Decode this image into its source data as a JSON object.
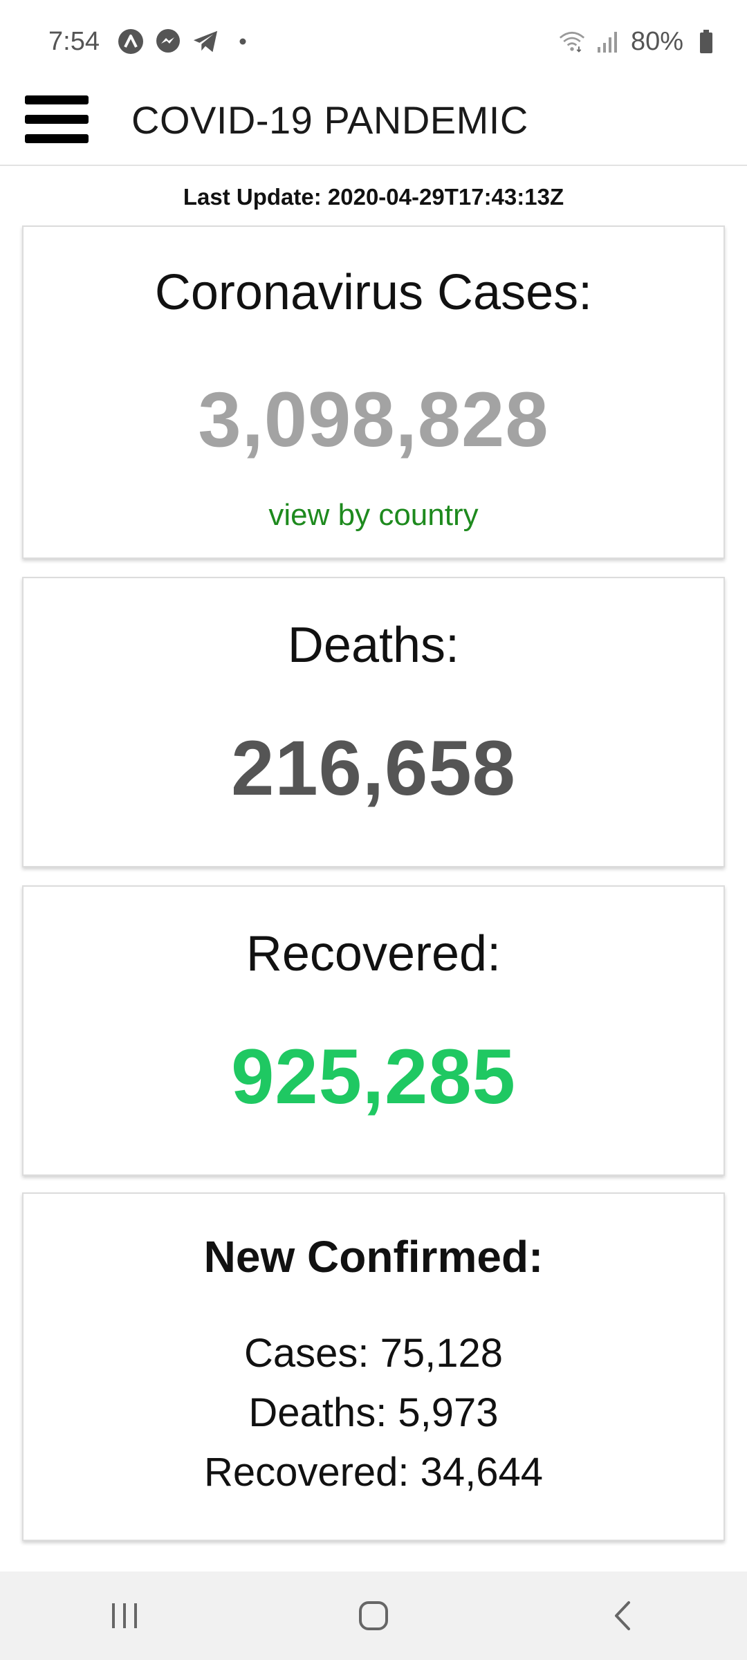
{
  "status_bar": {
    "time": "7:54",
    "battery": "80%",
    "icons": [
      "app-a-icon",
      "messenger-icon",
      "telegram-icon",
      "notification-dot-icon",
      "wifi-icon",
      "signal-icon",
      "battery-icon"
    ]
  },
  "app_bar": {
    "title": "COVID-19 PANDEMIC",
    "menu_icon": "hamburger-menu-icon"
  },
  "last_update": "Last Update: 2020-04-29T17:43:13Z",
  "cards": {
    "cases": {
      "heading": "Coronavirus Cases:",
      "value": "3,098,828",
      "link": "view by country",
      "value_color": "#a3a3a3",
      "link_color": "#1e8a1e"
    },
    "deaths": {
      "heading": "Deaths:",
      "value": "216,658",
      "value_color": "#555555"
    },
    "recovered": {
      "heading": "Recovered:",
      "value": "925,285",
      "value_color": "#1fc862"
    },
    "new_confirmed": {
      "heading": "New Confirmed:",
      "cases": "Cases: 75,128",
      "deaths": "Deaths: 5,973",
      "recovered": "Recovered: 34,644"
    }
  },
  "nav_bar": {
    "icons": [
      "recent-apps-icon",
      "home-icon",
      "back-icon"
    ]
  }
}
